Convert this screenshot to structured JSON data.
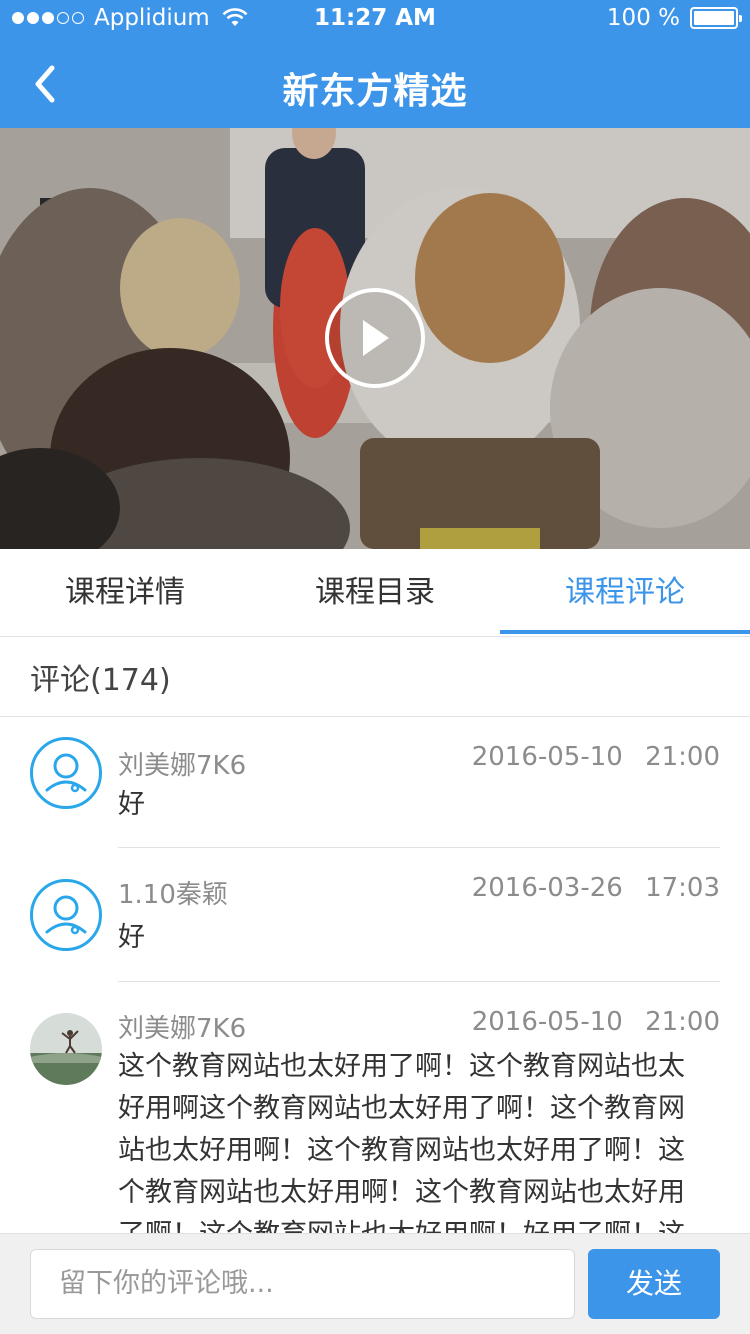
{
  "status_bar": {
    "carrier": "Applidium",
    "time": "11:27 AM",
    "battery": "100 %",
    "signal_icon": "signal-dots-icon",
    "wifi_icon": "wifi-icon",
    "battery_icon": "battery-icon"
  },
  "nav": {
    "title": "新东方精选",
    "back_icon": "chevron-left-icon"
  },
  "video": {
    "play_icon": "play-icon"
  },
  "tabs": [
    {
      "label": "课程详情",
      "active": false
    },
    {
      "label": "课程目录",
      "active": false
    },
    {
      "label": "课程评论",
      "active": true
    }
  ],
  "comments_header": {
    "label": "评论(174)"
  },
  "comments": [
    {
      "user": "刘美娜7K6",
      "date": "2016-05-10   21:00",
      "text": "好",
      "avatar": "user-placeholder-icon"
    },
    {
      "user": "1.10秦颖",
      "date": "2016-03-26   17:03",
      "text": "好",
      "avatar": "user-placeholder-icon"
    },
    {
      "user": "刘美娜7K6",
      "date": "2016-05-10   21:00",
      "avatar": "photo-avatar",
      "lines": [
        "这个教育网站也太好用了啊！这个教育网站也太",
        "好用啊这个教育网站也太好用了啊！这个教育网",
        "站也太好用啊！这个教育网站也太好用了啊！这",
        "个教育网站也太好用啊！这个教育网站也太好用",
        "了啊！这个教育网站也太好用啊！好用了啊！这"
      ]
    }
  ],
  "input_bar": {
    "placeholder": "留下你的评论哦...",
    "send_label": "发送"
  },
  "colors": {
    "brand": "#3d95ea",
    "avatar_ring": "#29a7ea",
    "divider": "#e2e2e2"
  }
}
